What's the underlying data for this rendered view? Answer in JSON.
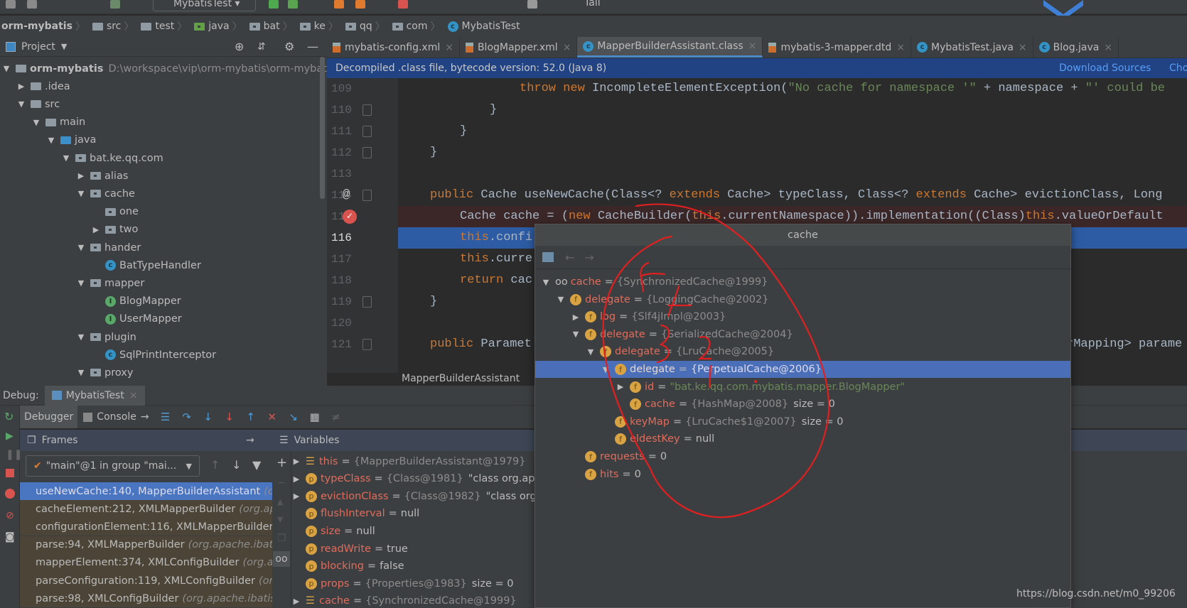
{
  "toolbar": {
    "run_config": "MybatisTest",
    "tail_label": "Tail"
  },
  "breadcrumb": [
    {
      "label": "orm-mybatis",
      "icon": "none"
    },
    {
      "label": "src",
      "icon": "folder"
    },
    {
      "label": "test",
      "icon": "folder"
    },
    {
      "label": "java",
      "icon": "test-root-folder"
    },
    {
      "label": "bat",
      "icon": "package"
    },
    {
      "label": "ke",
      "icon": "package"
    },
    {
      "label": "qq",
      "icon": "package"
    },
    {
      "label": "com",
      "icon": "package"
    },
    {
      "label": "MybatisTest",
      "icon": "class"
    }
  ],
  "project": {
    "title": "Project",
    "tree": [
      {
        "label": "orm-mybatis",
        "path": "D:\\workspace\\vip\\orm-mybatis\\orm-mybatis",
        "level": 0,
        "arrow": "down",
        "icon": "module"
      },
      {
        "label": ".idea",
        "level": 1,
        "arrow": "right",
        "icon": "folder"
      },
      {
        "label": "src",
        "level": 1,
        "arrow": "down",
        "icon": "folder"
      },
      {
        "label": "main",
        "level": 2,
        "arrow": "down",
        "icon": "folder"
      },
      {
        "label": "java",
        "level": 3,
        "arrow": "down",
        "icon": "source-folder"
      },
      {
        "label": "bat.ke.qq.com",
        "level": 4,
        "arrow": "down",
        "icon": "package"
      },
      {
        "label": "alias",
        "level": 5,
        "arrow": "right",
        "icon": "package"
      },
      {
        "label": "cache",
        "level": 5,
        "arrow": "down",
        "icon": "package"
      },
      {
        "label": "one",
        "level": 6,
        "arrow": "none",
        "icon": "package"
      },
      {
        "label": "two",
        "level": 6,
        "arrow": "right",
        "icon": "package"
      },
      {
        "label": "hander",
        "level": 5,
        "arrow": "down",
        "icon": "package"
      },
      {
        "label": "BatTypeHandler",
        "level": 6,
        "arrow": "none",
        "icon": "class"
      },
      {
        "label": "mapper",
        "level": 5,
        "arrow": "down",
        "icon": "package"
      },
      {
        "label": "BlogMapper",
        "level": 6,
        "arrow": "none",
        "icon": "interface"
      },
      {
        "label": "UserMapper",
        "level": 6,
        "arrow": "none",
        "icon": "interface"
      },
      {
        "label": "plugin",
        "level": 5,
        "arrow": "down",
        "icon": "package"
      },
      {
        "label": "SqlPrintInterceptor",
        "level": 6,
        "arrow": "none",
        "icon": "class"
      },
      {
        "label": "proxy",
        "level": 5,
        "arrow": "down",
        "icon": "package"
      }
    ]
  },
  "tabs": [
    {
      "label": "mybatis-config.xml",
      "icon": "xml",
      "active": false
    },
    {
      "label": "BlogMapper.xml",
      "icon": "xml",
      "active": false
    },
    {
      "label": "MapperBuilderAssistant.class",
      "icon": "class",
      "active": true
    },
    {
      "label": "mybatis-3-mapper.dtd",
      "icon": "dtd",
      "active": false
    },
    {
      "label": "MybatisTest.java",
      "icon": "class",
      "active": false
    },
    {
      "label": "Blog.java",
      "icon": "class",
      "active": false
    }
  ],
  "banner": {
    "text": "Decompiled .class file, bytecode version: 52.0 (Java 8)",
    "download": "Download Sources",
    "choose": "Cho"
  },
  "code": [
    {
      "n": "109",
      "indent": 3,
      "tokens": [
        [
          "throw new ",
          "k"
        ],
        [
          "IncompleteElementException(",
          "t"
        ],
        [
          "\"No cache for namespace '\"",
          "s"
        ],
        [
          " + namespace + ",
          "t"
        ],
        [
          "\"' could be",
          "s"
        ]
      ]
    },
    {
      "n": "110",
      "indent": 2,
      "tokens": [
        [
          "}",
          "t"
        ]
      ],
      "fold": true
    },
    {
      "n": "111",
      "indent": 1,
      "tokens": [
        [
          "}",
          "t"
        ]
      ],
      "fold": true
    },
    {
      "n": "112",
      "indent": 0,
      "tokens": [
        [
          "}",
          "t"
        ]
      ],
      "fold": true
    },
    {
      "n": "113",
      "indent": 0,
      "tokens": []
    },
    {
      "n": "114",
      "indent": 0,
      "tokens": [
        [
          "public ",
          "k"
        ],
        [
          "Cache useNewCache(Class<? ",
          "t"
        ],
        [
          "extends ",
          "k"
        ],
        [
          "Cache> typeClass, Class<? ",
          "t"
        ],
        [
          "extends ",
          "k"
        ],
        [
          "Cache> evictionClass, Long",
          "t"
        ]
      ],
      "marker": "@",
      "fold": true
    },
    {
      "n": "115",
      "indent": 1,
      "tokens": [
        [
          "Cache cache = (",
          "t"
        ],
        [
          "new ",
          "k"
        ],
        [
          "CacheBuilder(",
          "t"
        ],
        [
          "this",
          "k"
        ],
        [
          ".currentNamespace)).implementation((Class)",
          "t"
        ],
        [
          "this",
          "k"
        ],
        [
          ".valueOrDefault",
          "t"
        ]
      ],
      "state": "breakpoint"
    },
    {
      "n": "116",
      "indent": 1,
      "tokens": [
        [
          "this",
          "k"
        ],
        [
          ".confi",
          "t"
        ]
      ],
      "state": "exec"
    },
    {
      "n": "117",
      "indent": 1,
      "tokens": [
        [
          "this",
          "k"
        ],
        [
          ".curre",
          "t"
        ]
      ]
    },
    {
      "n": "118",
      "indent": 1,
      "tokens": [
        [
          "return ",
          "k"
        ],
        [
          "cac",
          "t"
        ]
      ]
    },
    {
      "n": "119",
      "indent": 0,
      "tokens": [
        [
          "}",
          "t"
        ]
      ],
      "fold": true
    },
    {
      "n": "120",
      "indent": 0,
      "tokens": []
    },
    {
      "n": "121",
      "indent": 0,
      "tokens": [
        [
          "public ",
          "k"
        ],
        [
          "Paramet",
          "t"
        ]
      ],
      "right": "rMapping> parame",
      "fold": true
    }
  ],
  "editor_breadcrumb": "MapperBuilderAssistant",
  "debug": {
    "label": "Debug:",
    "session": "MybatisTest",
    "debugger_tab": "Debugger",
    "console_tab": "Console",
    "frames_title": "Frames",
    "variables_title": "Variables",
    "thread": "\"main\"@1 in group \"mai...",
    "frames": [
      {
        "method": "useNewCache:140, MapperBuilderAssistant",
        "pkg": "(org",
        "selected": true
      },
      {
        "method": "cacheElement:212, XMLMapperBuilder",
        "pkg": "(org.apa"
      },
      {
        "method": "configurationElement:116, XMLMapperBuilder",
        "pkg": "("
      },
      {
        "method": "parse:94, XMLMapperBuilder",
        "pkg": "(org.apache.ibatis"
      },
      {
        "method": "mapperElement:374, XMLConfigBuilder",
        "pkg": "(org.ap"
      },
      {
        "method": "parseConfiguration:119, XMLConfigBuilder",
        "pkg": "(org"
      },
      {
        "method": "parse:98, XMLConfigBuilder",
        "pkg": "(org.apache.ibatis.b"
      }
    ],
    "variables": [
      {
        "name": "this",
        "value": "{MapperBuilderAssistant@1979}",
        "extra": "",
        "icon": "stack",
        "arrow": true
      },
      {
        "name": "typeClass",
        "value": "{Class@1981}",
        "extra": "\"class org.apach",
        "icon": "p",
        "arrow": true
      },
      {
        "name": "evictionClass",
        "value": "{Class@1982}",
        "extra": "\"class org.ap",
        "icon": "p",
        "arrow": true
      },
      {
        "name": "flushInterval",
        "plain": "null",
        "icon": "p"
      },
      {
        "name": "size",
        "plain": "null",
        "icon": "p"
      },
      {
        "name": "readWrite",
        "plain": "true",
        "icon": "p"
      },
      {
        "name": "blocking",
        "plain": "false",
        "icon": "p"
      },
      {
        "name": "props",
        "value": "{Properties@1983}",
        "extra": "size = 0",
        "icon": "p"
      },
      {
        "name": "cache",
        "value": "{SynchronizedCache@1999}",
        "extra": "",
        "icon": "stack",
        "arrow": true
      }
    ]
  },
  "popup": {
    "title": "cache",
    "rows": [
      {
        "level": 0,
        "arrow": "down",
        "icon": "watch",
        "name": "cache",
        "value": "{SynchronizedCache@1999}"
      },
      {
        "level": 1,
        "arrow": "down",
        "icon": "f",
        "name": "delegate",
        "value": "{LoggingCache@2002}"
      },
      {
        "level": 2,
        "arrow": "right",
        "icon": "f",
        "name": "log",
        "value": "{Slf4jImpl@2003}"
      },
      {
        "level": 2,
        "arrow": "down",
        "icon": "f",
        "name": "delegate",
        "value": "{SerializedCache@2004}"
      },
      {
        "level": 3,
        "arrow": "down",
        "icon": "f",
        "name": "delegate",
        "value": "{LruCache@2005}"
      },
      {
        "level": 4,
        "arrow": "down",
        "icon": "f",
        "name": "delegate",
        "value": "{PerpetualCache@2006}",
        "selected": true
      },
      {
        "level": 5,
        "arrow": "right",
        "icon": "f",
        "name": "id",
        "string": "\"bat.ke.qq.com.mybatis.mapper.BlogMapper\""
      },
      {
        "level": 5,
        "arrow": "none",
        "icon": "f",
        "name": "cache",
        "value": "{HashMap@2008}",
        "extra": "size = 0"
      },
      {
        "level": 4,
        "arrow": "none",
        "icon": "f",
        "name": "keyMap",
        "value": "{LruCache$1@2007}",
        "extra": "size = 0"
      },
      {
        "level": 4,
        "arrow": "none",
        "icon": "f",
        "name": "eldestKey",
        "plain": "null"
      },
      {
        "level": 2,
        "arrow": "none",
        "icon": "f",
        "name": "requests",
        "plain": "0"
      },
      {
        "level": 2,
        "arrow": "none",
        "icon": "f",
        "name": "hits",
        "plain": "0"
      }
    ]
  },
  "annotation_numbers": [
    "5",
    "4",
    "3",
    "2",
    "1"
  ],
  "watermark": "https://blog.csdn.net/m0_99206",
  "colors": {
    "keyword": "#cc7832",
    "string": "#6a8759",
    "selection": "#4a6fb8",
    "annotation": "#e02020"
  }
}
